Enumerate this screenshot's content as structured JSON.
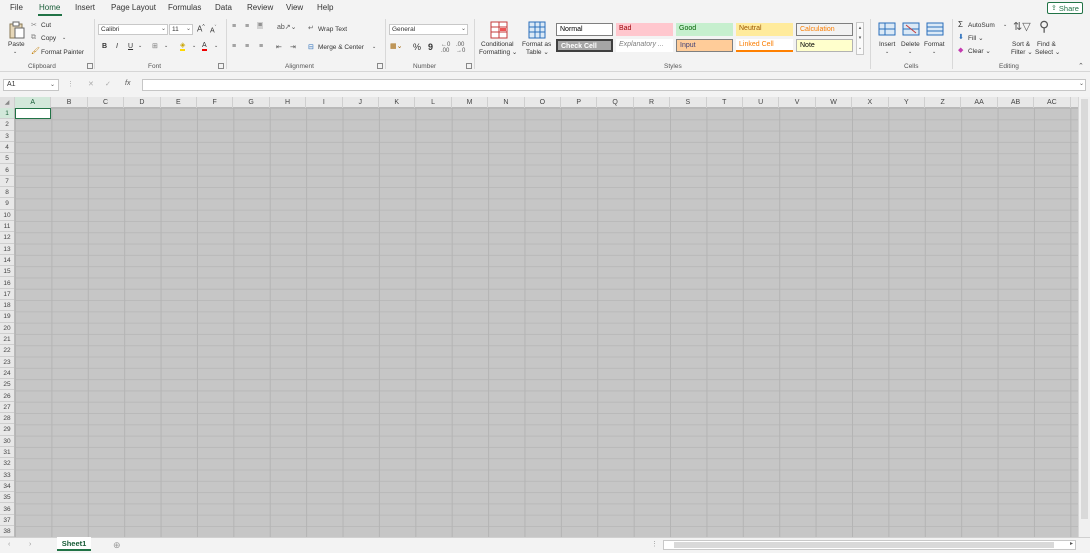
{
  "menu": {
    "file": "File",
    "home": "Home",
    "insert": "Insert",
    "page_layout": "Page Layout",
    "formulas": "Formulas",
    "data": "Data",
    "review": "Review",
    "view": "View",
    "help": "Help",
    "share": "Share"
  },
  "clipboard": {
    "paste": "Paste",
    "cut": "Cut",
    "copy": "Copy",
    "format_painter": "Format Painter",
    "label": "Clipboard"
  },
  "font": {
    "family": "Calibri",
    "size": "11",
    "bold": "B",
    "italic": "I",
    "underline": "U",
    "grow": "A",
    "shrink": "A",
    "font_color_letter": "A",
    "label": "Font"
  },
  "alignment": {
    "wrap_text": "Wrap Text",
    "merge_center": "Merge & Center",
    "label": "Alignment"
  },
  "number": {
    "format": "General",
    "percent": "%",
    "comma": "9",
    "label": "Number"
  },
  "styles": {
    "conditional_formatting_1": "Conditional",
    "conditional_formatting_2": "Formatting",
    "format_as_table_1": "Format as",
    "format_as_table_2": "Table",
    "cells": [
      {
        "label": "Normal",
        "bg": "#ffffff",
        "fg": "#000000",
        "border": "#7f7f7f"
      },
      {
        "label": "Bad",
        "bg": "#ffc7ce",
        "fg": "#9c0006",
        "border": "#ffc7ce"
      },
      {
        "label": "Good",
        "bg": "#c6efce",
        "fg": "#006100",
        "border": "#c6efce"
      },
      {
        "label": "Neutral",
        "bg": "#ffeb9c",
        "fg": "#9c5700",
        "border": "#ffeb9c"
      },
      {
        "label": "Calculation",
        "bg": "#f2f2f2",
        "fg": "#fa7d00",
        "border": "#7f7f7f"
      },
      {
        "label": "Check Cell",
        "bg": "#a5a5a5",
        "fg": "#ffffff",
        "border": "#3f3f3f"
      },
      {
        "label": "Explanatory ...",
        "bg": "#ffffff",
        "fg": "#7f7f7f",
        "border": "#ffffff"
      },
      {
        "label": "Input",
        "bg": "#ffcc99",
        "fg": "#3f3f76",
        "border": "#7f7f7f"
      },
      {
        "label": "Linked Cell",
        "bg": "#ffffff",
        "fg": "#fa7d00",
        "border": "#ff8001"
      },
      {
        "label": "Note",
        "bg": "#ffffcc",
        "fg": "#000000",
        "border": "#b2b2b2"
      }
    ],
    "label": "Styles"
  },
  "cells_group": {
    "insert": "Insert",
    "delete": "Delete",
    "format": "Format",
    "label": "Cells"
  },
  "editing": {
    "autosum": "AutoSum",
    "fill": "Fill",
    "clear": "Clear",
    "sort_1": "Sort &",
    "sort_2": "Filter",
    "find_1": "Find &",
    "find_2": "Select",
    "label": "Editing"
  },
  "formula_bar": {
    "name_box": "A1",
    "fx": "fx",
    "value": ""
  },
  "grid": {
    "columns": [
      "A",
      "B",
      "C",
      "D",
      "E",
      "F",
      "G",
      "H",
      "I",
      "J",
      "K",
      "L",
      "M",
      "N",
      "O",
      "P",
      "Q",
      "R",
      "S",
      "T",
      "U",
      "V",
      "W",
      "X",
      "Y",
      "Z",
      "AA",
      "AB",
      "AC"
    ],
    "rows": [
      "1",
      "2",
      "3",
      "4",
      "5",
      "6",
      "7",
      "8",
      "9",
      "10",
      "11",
      "12",
      "13",
      "14",
      "15",
      "16",
      "17",
      "18",
      "19",
      "20",
      "21",
      "22",
      "23",
      "24",
      "25",
      "26",
      "27",
      "28",
      "29",
      "30",
      "31",
      "32",
      "33",
      "34",
      "35",
      "36",
      "37",
      "38"
    ],
    "active_cell": "A1"
  },
  "sheets": {
    "active": "Sheet1"
  },
  "colors": {
    "accent": "#217346",
    "accent_dark": "#185c37"
  }
}
